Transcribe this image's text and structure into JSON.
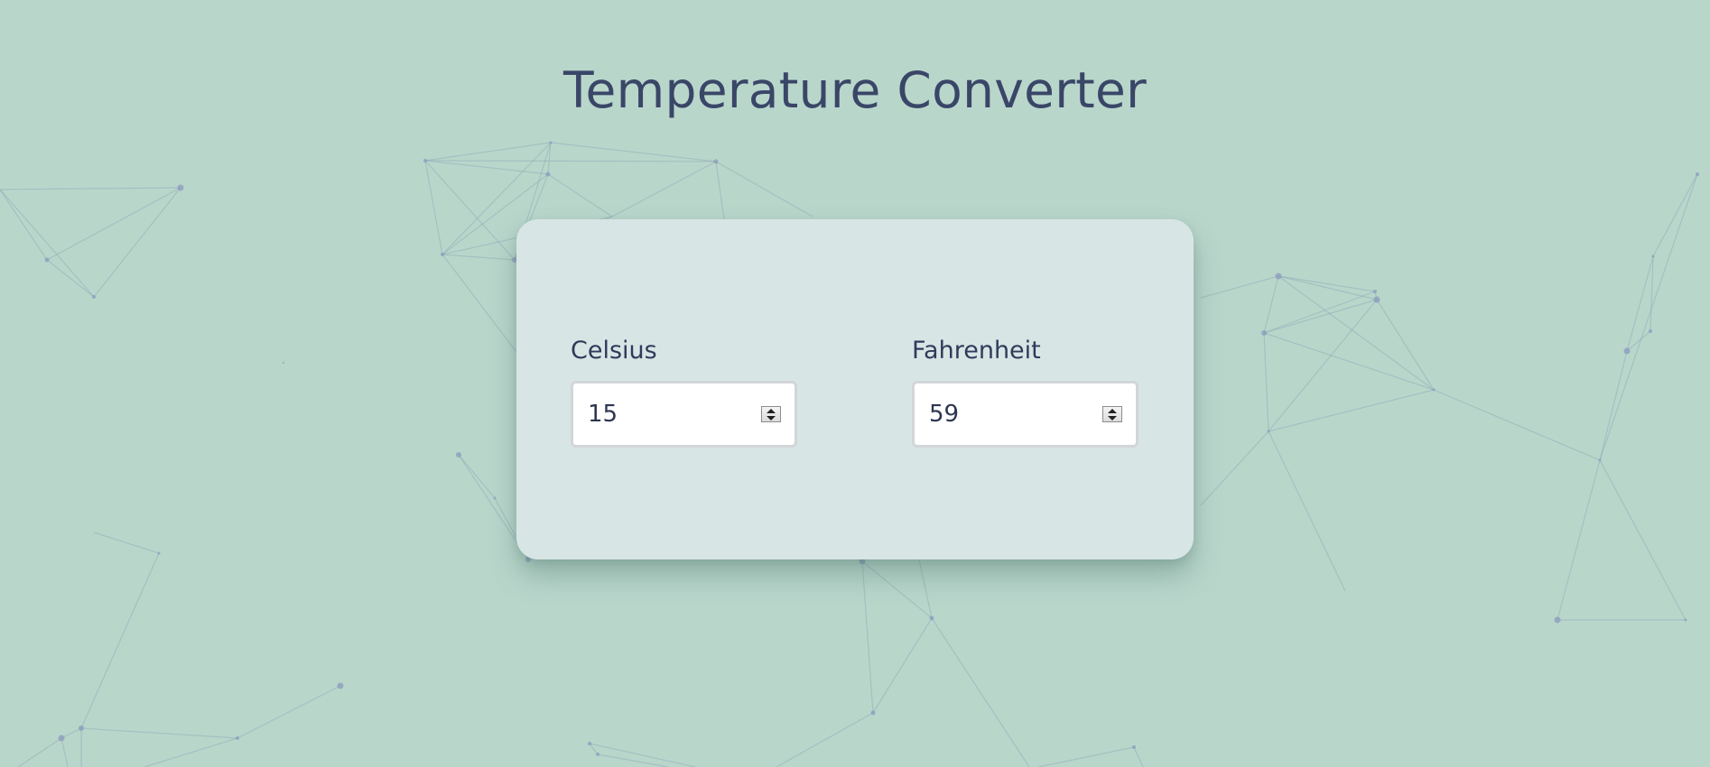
{
  "title": "Temperature Converter",
  "celsius": {
    "label": "Celsius",
    "value": "15"
  },
  "fahrenheit": {
    "label": "Fahrenheit",
    "value": "59"
  },
  "colors": {
    "background": "#b9d6cb",
    "card": "#d8e5e5",
    "title": "#3a4667",
    "network_lines": "#8ea6b4",
    "network_nodes": "#8b9bbd"
  },
  "icons": {
    "spinner": "spin-button-icon",
    "spin_up": "arrow-up-icon",
    "spin_down": "arrow-down-icon"
  }
}
